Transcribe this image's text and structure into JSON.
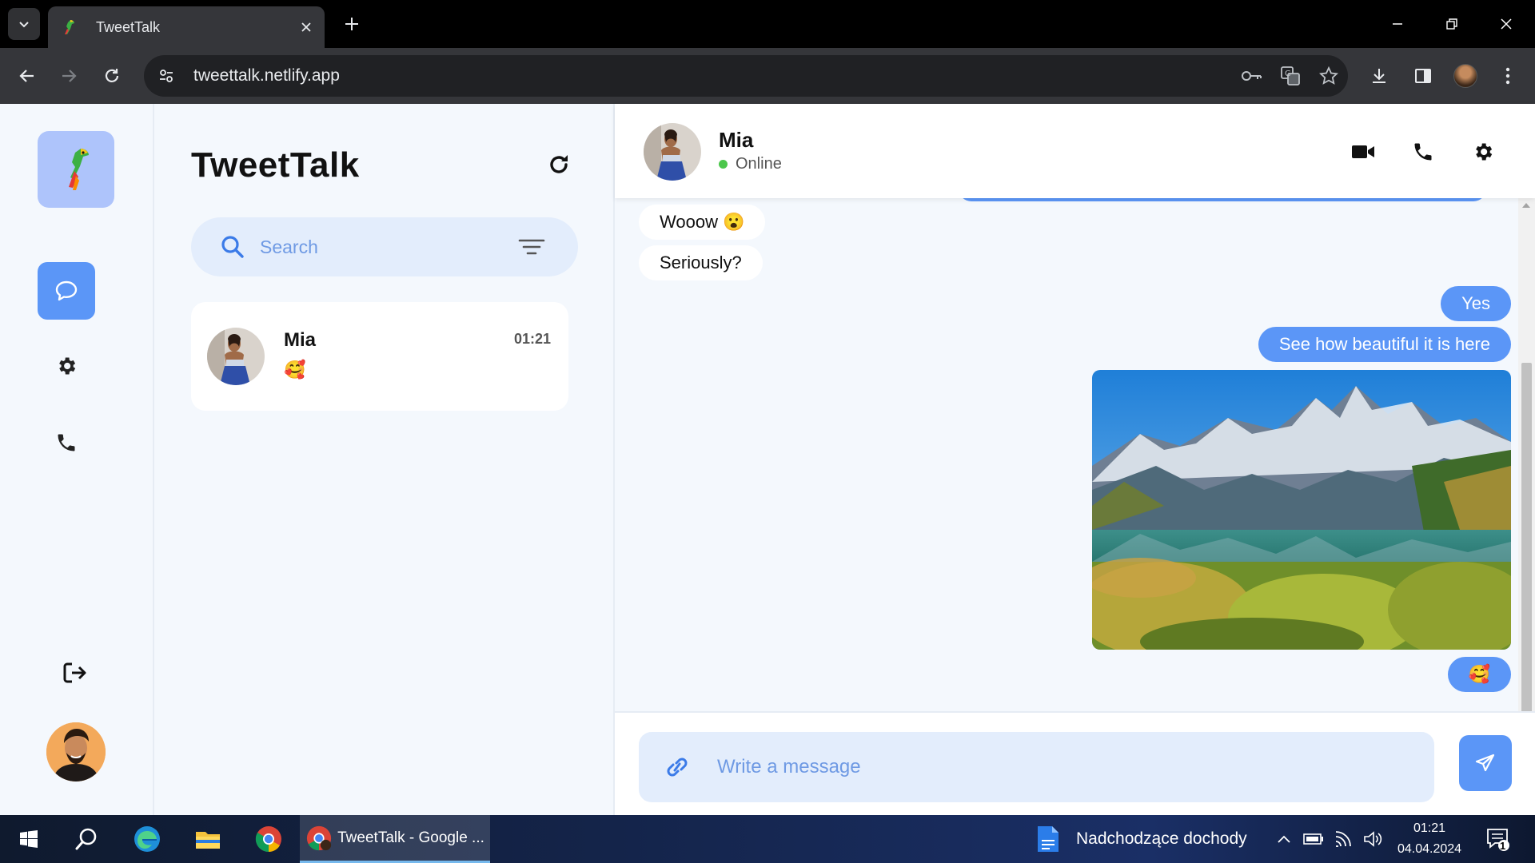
{
  "browser": {
    "tab_title": "TweetTalk",
    "url": "tweettalk.netlify.app"
  },
  "app": {
    "title": "TweetTalk",
    "search_placeholder": "Search",
    "conversations": [
      {
        "name": "Mia",
        "time": "01:21",
        "last_message": "🥰"
      }
    ],
    "chat": {
      "contact_name": "Mia",
      "status": "Online",
      "messages": [
        {
          "direction": "incoming",
          "text": "Wooow 😮"
        },
        {
          "direction": "incoming",
          "text": "Seriously?"
        },
        {
          "direction": "outgoing",
          "text": "Yes"
        },
        {
          "direction": "outgoing",
          "text": "See how beautiful it is here"
        },
        {
          "direction": "outgoing",
          "type": "image",
          "image": "mountain-lake-photo"
        },
        {
          "direction": "outgoing",
          "text": "🥰"
        }
      ],
      "composer_placeholder": "Write a message"
    },
    "accent_color": "#5b96f7",
    "online_color": "#4cc74c"
  },
  "taskbar": {
    "active_window": "TweetTalk - Google ...",
    "widget_text": "Nadchodzące dochody",
    "clock_time": "01:21",
    "clock_date": "04.04.2024",
    "notification_count": "1"
  }
}
